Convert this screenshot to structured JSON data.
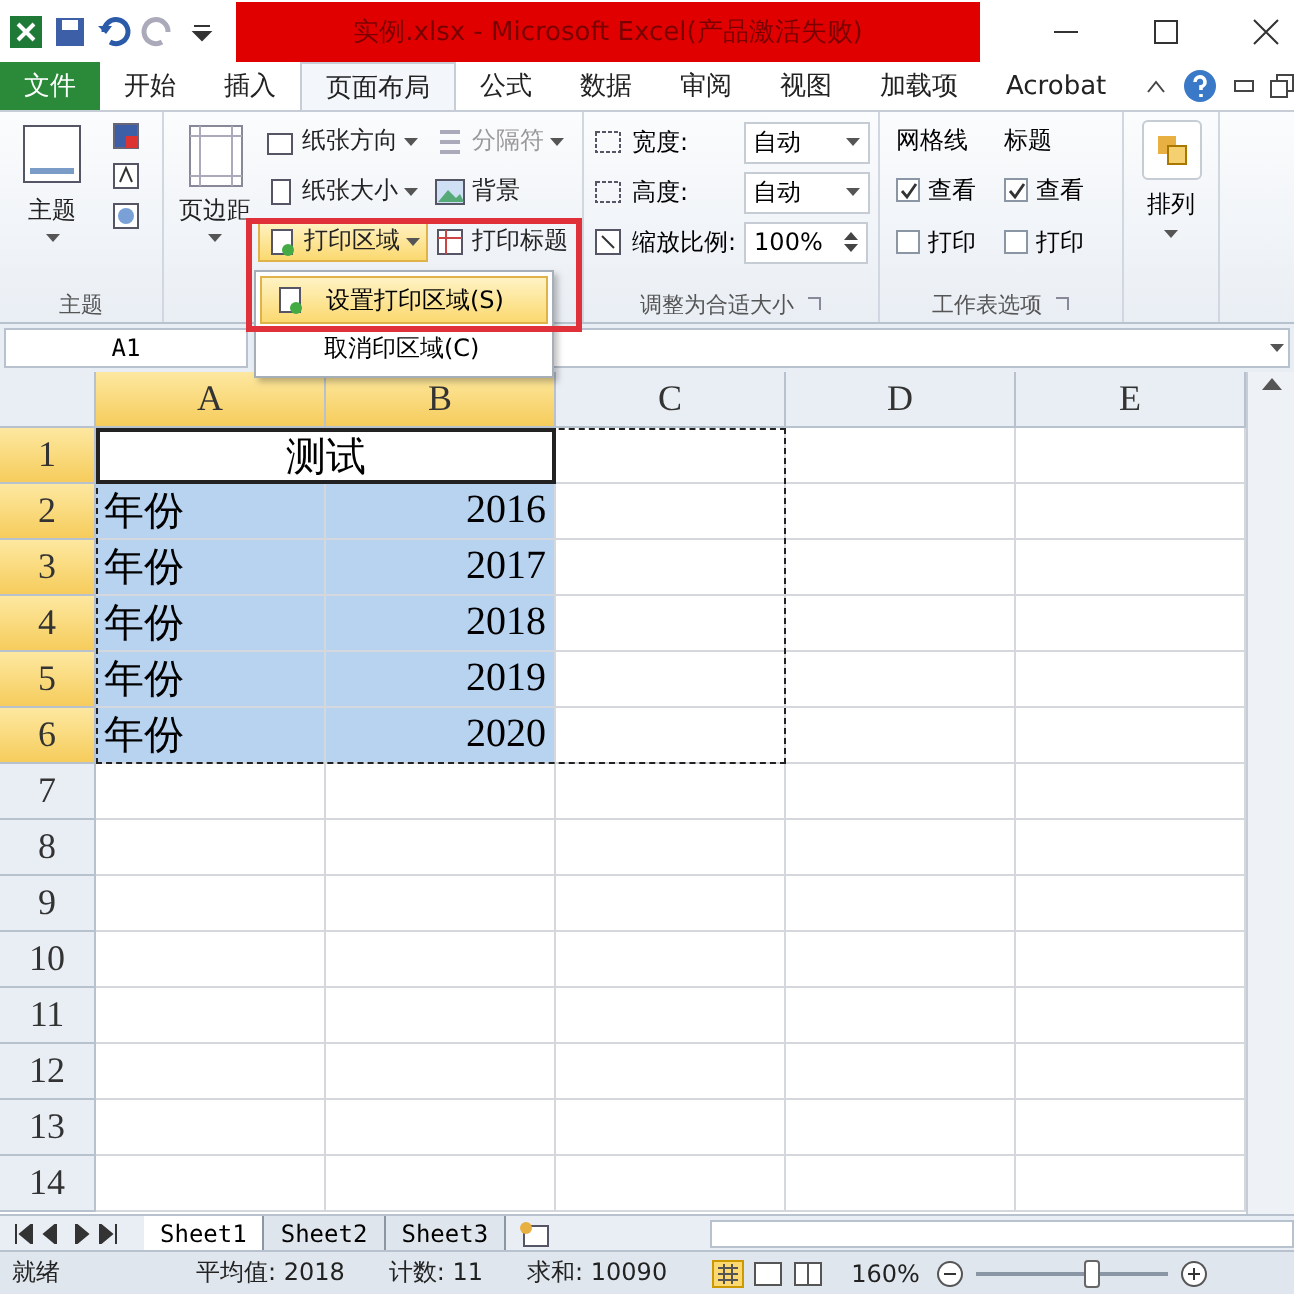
{
  "title": "实例.xlsx - Microsoft Excel(产品激活失败)",
  "tabs": [
    {
      "label": "文件",
      "kind": "file",
      "selected": false
    },
    {
      "label": "开始",
      "kind": "tab",
      "selected": false
    },
    {
      "label": "插入",
      "kind": "tab",
      "selected": false
    },
    {
      "label": "页面布局",
      "kind": "tab",
      "selected": true
    },
    {
      "label": "公式",
      "kind": "tab",
      "selected": false
    },
    {
      "label": "数据",
      "kind": "tab",
      "selected": false
    },
    {
      "label": "审阅",
      "kind": "tab",
      "selected": false
    },
    {
      "label": "视图",
      "kind": "tab",
      "selected": false
    },
    {
      "label": "加载项",
      "kind": "tab",
      "selected": false
    },
    {
      "label": "Acrobat",
      "kind": "tab",
      "selected": false
    }
  ],
  "theme_group": {
    "label": "主题",
    "button": "主题"
  },
  "page_setup": {
    "margins": "页边距",
    "orientation": "纸张方向",
    "breaks": {
      "label": "分隔符",
      "disabled": true
    },
    "size": "纸张大小",
    "background": "背景",
    "print_area": {
      "label": "打印区域",
      "expanded": true
    },
    "print_titles": "打印标题"
  },
  "scale_group": {
    "label": "调整为合适大小",
    "fields": [
      {
        "label": "宽度:",
        "value": "自动"
      },
      {
        "label": "高度:",
        "value": "自动"
      }
    ],
    "scale": {
      "label": "缩放比例:",
      "value": "100%"
    }
  },
  "sheet_options": {
    "label": "工作表选项",
    "columns": [
      {
        "title": "网格线",
        "options": [
          {
            "label": "查看",
            "checked": true
          },
          {
            "label": "打印",
            "checked": false
          }
        ]
      },
      {
        "title": "标题",
        "options": [
          {
            "label": "查看",
            "checked": true
          },
          {
            "label": "打印",
            "checked": false
          }
        ]
      }
    ]
  },
  "arrange": {
    "label": "排列"
  },
  "menu": [
    {
      "label": "设置打印区域(S)",
      "selected": true
    },
    {
      "label": "取消印区域(C)",
      "selected": false
    }
  ],
  "name_box": "A1",
  "columns": [
    {
      "label": "A",
      "selected": true
    },
    {
      "label": "B",
      "selected": true
    },
    {
      "label": "C",
      "selected": false
    },
    {
      "label": "D",
      "selected": false
    },
    {
      "label": "E",
      "selected": false
    }
  ],
  "rows": [
    {
      "label": "1",
      "selected": true,
      "merged": "测试"
    },
    {
      "label": "2",
      "selected": true,
      "cells": [
        "年份",
        "2016"
      ]
    },
    {
      "label": "3",
      "selected": true,
      "cells": [
        "年份",
        "2017"
      ]
    },
    {
      "label": "4",
      "selected": true,
      "cells": [
        "年份",
        "2018"
      ]
    },
    {
      "label": "5",
      "selected": true,
      "cells": [
        "年份",
        "2019"
      ]
    },
    {
      "label": "6",
      "selected": true,
      "cells": [
        "年份",
        "2020"
      ]
    },
    {
      "label": "7",
      "selected": false
    },
    {
      "label": "8",
      "selected": false
    },
    {
      "label": "9",
      "selected": false
    },
    {
      "label": "10",
      "selected": false
    },
    {
      "label": "11",
      "selected": false
    },
    {
      "label": "12",
      "selected": false
    },
    {
      "label": "13",
      "selected": false
    },
    {
      "label": "14",
      "selected": false
    }
  ],
  "sheets": [
    {
      "label": "Sheet1",
      "selected": true
    },
    {
      "label": "Sheet2",
      "selected": false
    },
    {
      "label": "Sheet3",
      "selected": false
    }
  ],
  "status": {
    "ready": "就绪",
    "stats": [
      "平均值: 2018",
      "计数: 11",
      "求和: 10090"
    ],
    "zoom": "160%",
    "zoom_slider": {
      "level": 0.62
    }
  }
}
